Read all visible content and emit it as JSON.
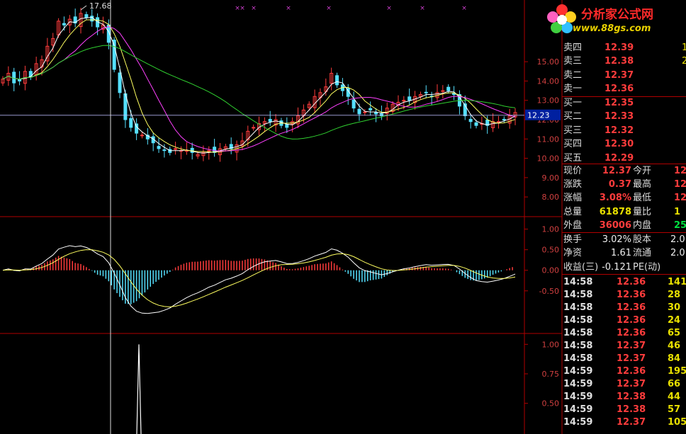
{
  "colors": {
    "up": "#ff3c3c",
    "down": "#55e0ff",
    "ma_white": "#ffffff",
    "ma_yellow": "#ffff60",
    "ma_magenta": "#ff40ff",
    "ma_green": "#30d030",
    "grid": "#7a0000",
    "price_marker_bg": "#0020a0"
  },
  "chart_data": [
    {
      "type": "candlestick",
      "title": "",
      "annotation_high": "17.68",
      "current_price_label": "12.23",
      "y_ticks": [
        "15.00",
        "14.00",
        "13.00",
        "12.00",
        "11.00",
        "10.00",
        "9.00",
        "8.00"
      ],
      "ylim": [
        7.2,
        17.9
      ],
      "close": [
        14.1,
        14.4,
        13.9,
        14.0,
        14.5,
        14.2,
        14.9,
        15.1,
        15.8,
        16.2,
        17.1,
        16.9,
        17.2,
        17.0,
        17.5,
        17.3,
        17.1,
        16.8,
        16.9,
        16.0,
        14.6,
        13.4,
        12.0,
        11.6,
        11.3,
        11.2,
        11.0,
        10.8,
        10.5,
        10.4,
        10.3,
        10.5,
        10.4,
        10.4,
        10.3,
        10.2,
        10.3,
        10.4,
        10.3,
        10.5,
        10.6,
        10.5,
        10.7,
        10.9,
        11.4,
        11.6,
        11.8,
        11.9,
        11.9,
        12.0,
        11.7,
        11.6,
        11.9,
        12.2,
        12.5,
        12.8,
        13.2,
        13.4,
        13.7,
        14.4,
        13.8,
        13.5,
        13.2,
        12.6,
        12.3,
        12.4,
        12.5,
        12.3,
        12.2,
        12.6,
        12.8,
        12.9,
        13.0,
        13.0,
        13.2,
        13.3,
        13.4,
        13.2,
        13.4,
        13.5,
        13.5,
        13.3,
        12.7,
        12.2,
        11.9,
        11.7,
        11.8,
        11.7,
        11.9,
        11.9,
        12.0,
        12.2,
        12.37
      ],
      "ma_lines": [
        "ma5",
        "ma10",
        "ma20",
        "ma60"
      ]
    },
    {
      "type": "macd",
      "y_ticks": [
        "1.00",
        "0.50",
        "0.00",
        "-0.50"
      ],
      "ylim": [
        -1.45,
        1.2
      ]
    },
    {
      "type": "line",
      "y_ticks": [
        "1.00",
        "0.75",
        "0.50"
      ],
      "ylim": [
        0.0,
        1.05
      ],
      "spike_index": 19,
      "spike_value": 1.0
    }
  ],
  "panel": {
    "logo": {
      "title": "分析家公式网",
      "url": "www.88gs.com"
    },
    "sell": [
      {
        "label": "卖四",
        "price": "12.39",
        "vol": "1"
      },
      {
        "label": "卖三",
        "price": "12.38",
        "vol": "2"
      },
      {
        "label": "卖二",
        "price": "12.37",
        "vol": ""
      },
      {
        "label": "卖一",
        "price": "12.36",
        "vol": ""
      }
    ],
    "buy": [
      {
        "label": "买一",
        "price": "12.35",
        "vol": ""
      },
      {
        "label": "买二",
        "price": "12.33",
        "vol": ""
      },
      {
        "label": "买三",
        "price": "12.32",
        "vol": ""
      },
      {
        "label": "买四",
        "price": "12.30",
        "vol": ""
      },
      {
        "label": "买五",
        "price": "12.29",
        "vol": ""
      }
    ],
    "quote": [
      {
        "l1": "现价",
        "v1": "12.37",
        "c1": "red",
        "l2": "今开",
        "v2": "12",
        "c2": "red"
      },
      {
        "l1": "涨跌",
        "v1": "0.37",
        "c1": "red",
        "l2": "最高",
        "v2": "12",
        "c2": "red"
      },
      {
        "l1": "涨幅",
        "v1": "3.08%",
        "c1": "red",
        "l2": "最低",
        "v2": "12",
        "c2": "red"
      },
      {
        "l1": "总量",
        "v1": "61878",
        "c1": "yel",
        "l2": "量比",
        "v2": "1",
        "c2": "yel"
      },
      {
        "l1": "外盘",
        "v1": "36006",
        "c1": "red",
        "l2": "内盘",
        "v2": "25",
        "c2": "grn"
      }
    ],
    "fin": [
      {
        "l1": "换手",
        "v1": "3.02%",
        "l2": "股本",
        "v2": "2.0"
      },
      {
        "l1": "净资",
        "v1": "1.61",
        "l2": "流通",
        "v2": "2.0"
      },
      {
        "l1": "收益(三)",
        "v1": "-0.121",
        "l2": "PE(动)",
        "v2": ""
      }
    ],
    "ticks": [
      {
        "time": "14:58",
        "price": "12.36",
        "vol": "141",
        "c": "red"
      },
      {
        "time": "14:58",
        "price": "12.36",
        "vol": "28",
        "c": "red"
      },
      {
        "time": "14:58",
        "price": "12.36",
        "vol": "30",
        "c": "red"
      },
      {
        "time": "14:58",
        "price": "12.36",
        "vol": "24",
        "c": "red"
      },
      {
        "time": "14:58",
        "price": "12.36",
        "vol": "65",
        "c": "red"
      },
      {
        "time": "14:58",
        "price": "12.37",
        "vol": "46",
        "c": "red"
      },
      {
        "time": "14:58",
        "price": "12.37",
        "vol": "84",
        "c": "red"
      },
      {
        "time": "14:59",
        "price": "12.36",
        "vol": "195",
        "c": "red"
      },
      {
        "time": "14:59",
        "price": "12.37",
        "vol": "66",
        "c": "red"
      },
      {
        "time": "14:59",
        "price": "12.38",
        "vol": "44",
        "c": "red"
      },
      {
        "time": "14:59",
        "price": "12.38",
        "vol": "57",
        "c": "red"
      },
      {
        "time": "14:59",
        "price": "12.37",
        "vol": "105",
        "c": "red"
      }
    ]
  }
}
